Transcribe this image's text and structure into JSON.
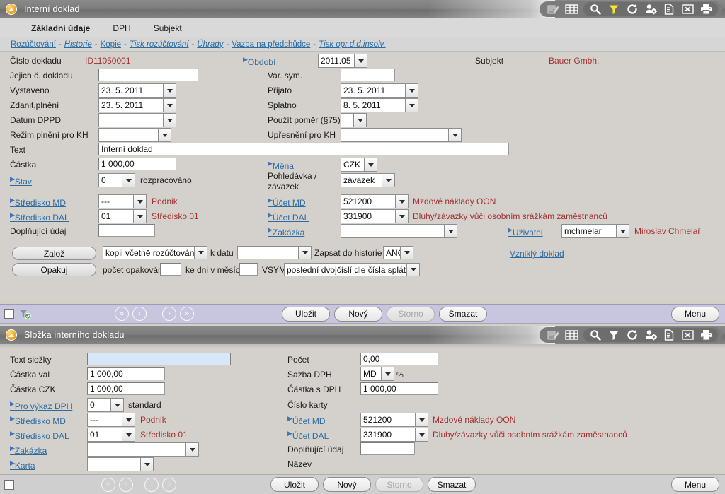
{
  "window1": {
    "title": "Interní doklad",
    "tabs": [
      {
        "label": "Základní údaje",
        "active": true
      },
      {
        "label": "DPH",
        "active": false
      },
      {
        "label": "Subjekt",
        "active": false
      }
    ],
    "links": [
      {
        "label": "Rozúčtování",
        "italic": false
      },
      {
        "label": "Historie",
        "italic": true
      },
      {
        "label": "Kopie",
        "italic": false
      },
      {
        "label": "Tisk rozúčtování",
        "italic": true
      },
      {
        "label": "Úhrady",
        "italic": true
      },
      {
        "label": "Vazba na předchůdce",
        "italic": false
      },
      {
        "label": "Tisk opr.d.d.insolv.",
        "italic": true
      }
    ],
    "fields": {
      "cislo_dokladu_label": "Číslo dokladu",
      "cislo_dokladu_value": "ID11050001",
      "obdobi_label": "Období",
      "obdobi_value": "2011.05",
      "subjekt_label": "Subjekt",
      "subjekt_value": "Bauer Gmbh.",
      "jejich_c_label": "Jejich č. dokladu",
      "jejich_c_value": "",
      "var_sym_label": "Var. sym.",
      "var_sym_value": "",
      "vystaveno_label": "Vystaveno",
      "vystaveno_value": "23. 5. 2011",
      "prijato_label": "Přijato",
      "prijato_value": "23. 5. 2011",
      "zdanit_label": "Zdanit.plnění",
      "zdanit_value": "23. 5. 2011",
      "splatno_label": "Splatno",
      "splatno_value": "8. 5. 2011",
      "dppd_label": "Datum DPPD",
      "dppd_value": "",
      "pomer_label": "Použít poměr (§75)",
      "pomer_value": "",
      "rezim_label": "Režim plnění pro KH",
      "rezim_value": "",
      "upresneni_label": "Upřesnění pro KH",
      "upresneni_value": "",
      "text_label": "Text",
      "text_value": "Interní doklad",
      "castka_label": "Částka",
      "castka_value": "1 000,00",
      "mena_label": "Měna",
      "mena_value": "CZK",
      "stav_label": "Stav",
      "stav_value": "0",
      "stav_desc": "rozpracováno",
      "pohledavka_label_line1": "Pohledávka /",
      "pohledavka_label_line2": "závazek",
      "pohledavka_value": "závazek",
      "stredisko_md_label": "Středisko MD",
      "stredisko_md_value": "---",
      "stredisko_md_desc": "Podnik",
      "ucet_md_label": "Účet MD",
      "ucet_md_value": "521200",
      "ucet_md_desc": "Mzdové náklady OON",
      "stredisko_dal_label": "Středisko DAL",
      "stredisko_dal_value": "01",
      "stredisko_dal_desc": "Středisko 01",
      "ucet_dal_label": "Účet DAL",
      "ucet_dal_value": "331900",
      "ucet_dal_desc": "Dluhy/závazky vůči osobním srážkám zaměstnanců",
      "doplnujici_label": "Doplňující údaj",
      "doplnujici_value": "",
      "zakazka_label": "Zakázka",
      "zakazka_value": "",
      "uzivatel_label": "Uživatel",
      "uzivatel_value": "mchmelar",
      "uzivatel_desc": "Miroslav Chmelař"
    },
    "actions": {
      "zaloz_label": "Založ",
      "zaloz_mode": "kopii včetně rozúčtování",
      "k_datu_label": "k datu",
      "k_datu_value": "",
      "zapsat_label": "Zapsat do historie",
      "zapsat_value": "ANO",
      "opakuj_label": "Opakuj",
      "pocet_opakovani_label": "počet opakování",
      "pocet_opakovani_value": "",
      "ke_dni_label": "ke dni v měsíci",
      "ke_dni_value": "",
      "vsym_label": "VSYM",
      "vsym_value": "poslední dvojčíslí dle čísla splátky",
      "vznikly_doklad": "Vzniklý doklad"
    },
    "toolbar": {
      "save": "Uložit",
      "new": "Nový",
      "cancel": "Storno",
      "delete": "Smazat",
      "menu": "Menu",
      "nav_first": "«",
      "nav_prev": "‹",
      "nav_next": "›",
      "nav_last": "»"
    }
  },
  "window2": {
    "title": "Složka interního dokladu",
    "fields": {
      "text_slozky_label": "Text složky",
      "text_slozky_value": "",
      "pocet_label": "Počet",
      "pocet_value": "0,00",
      "castka_val_label": "Částka val",
      "castka_val_value": "1 000,00",
      "sazba_dph_label": "Sazba DPH",
      "sazba_dph_value": "MD",
      "sazba_dph_unit": "%",
      "castka_czk_label": "Částka CZK",
      "castka_czk_value": "1 000,00",
      "castka_s_dph_label": "Částka s DPH",
      "castka_s_dph_value": "1 000,00",
      "pro_vykaz_label": "Pro výkaz DPH",
      "pro_vykaz_value": "0",
      "pro_vykaz_desc": "standard",
      "cislo_karty_label": "Číslo karty",
      "stredisko_md_label": "Středisko MD",
      "stredisko_md_value": "---",
      "stredisko_md_desc": "Podnik",
      "ucet_md_label": "Účet MD",
      "ucet_md_value": "521200",
      "ucet_md_desc": "Mzdové náklady OON",
      "stredisko_dal_label": "Středisko DAL",
      "stredisko_dal_value": "01",
      "stredisko_dal_desc": "Středisko 01",
      "ucet_dal_label": "Účet DAL",
      "ucet_dal_value": "331900",
      "ucet_dal_desc": "Dluhy/závazky vůči osobním srážkám zaměstnanců",
      "zakazka_label": "Zakázka",
      "zakazka_value": "",
      "doplnujici_label": "Doplňující údaj",
      "doplnujici_value": "",
      "karta_label": "Karta",
      "karta_value": "",
      "nazev_label": "Název"
    },
    "toolbar": {
      "save": "Uložit",
      "new": "Nový",
      "cancel": "Storno",
      "delete": "Smazat",
      "menu": "Menu",
      "nav_first": "«",
      "nav_prev": "‹",
      "nav_next": "›",
      "nav_last": "»"
    }
  },
  "icons": {
    "app": "app-logo-icon",
    "edit": "edit-icon",
    "grid": "grid-icon",
    "search": "search-icon",
    "filter": "filter-icon",
    "refresh": "refresh-icon",
    "user": "user-settings-icon",
    "doc": "document-icon",
    "excel": "export-excel-icon",
    "print": "print-icon"
  },
  "colors": {
    "accent_link": "#2b6ca3",
    "value_red": "#a33232",
    "filter_yellow": "#f2e62e",
    "titlebar": "#7d7d7d",
    "toolbar_purple": "#c8c6de",
    "panel_bg": "#d4d0cb"
  }
}
